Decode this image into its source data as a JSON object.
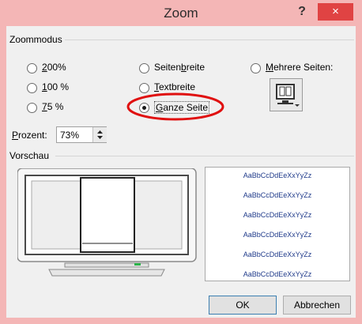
{
  "window": {
    "title": "Zoom",
    "help_label": "?",
    "close_label": "×"
  },
  "zoommodus": {
    "label": "Zoommodus",
    "options_left": [
      {
        "pre": "",
        "key": "2",
        "post": "00%"
      },
      {
        "pre": "",
        "key": "1",
        "post": "00 %"
      },
      {
        "pre": "",
        "key": "7",
        "post": "5 %"
      }
    ],
    "options_mid": [
      {
        "pre": "Seiten",
        "key": "b",
        "post": "reite"
      },
      {
        "pre": "",
        "key": "T",
        "post": "extbreite"
      },
      {
        "pre": "",
        "key": "G",
        "post": "anze Seite"
      }
    ],
    "selected": "Ganze Seite",
    "mehrere": {
      "pre": "",
      "key": "M",
      "post": "ehrere Seiten:"
    },
    "prozent_label_key": "P",
    "prozent_label_rest": "rozent:",
    "prozent_value": "73%"
  },
  "vorschau": {
    "label": "Vorschau",
    "sample_text": "AaBbCcDdEeXxYyZz",
    "sample_lines": [
      "AaBbCcDdEeXxYyZz",
      "AaBbCcDdEeXxYyZz",
      "AaBbCcDdEeXxYyZz",
      "AaBbCcDdEeXxYyZz",
      "AaBbCcDdEeXxYyZz",
      "AaBbCcDdEeXxYyZz"
    ]
  },
  "buttons": {
    "ok": "OK",
    "cancel": "Abbrechen"
  },
  "colors": {
    "frame": "#f4b6b6",
    "close": "#e04343",
    "highlight_ellipse": "#e01010"
  }
}
